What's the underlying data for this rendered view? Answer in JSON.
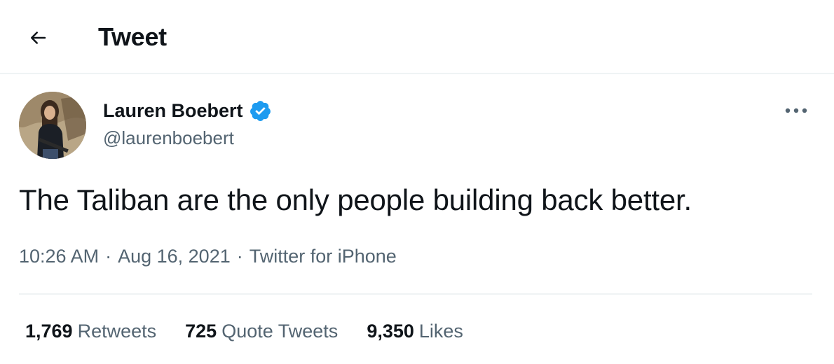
{
  "header": {
    "title": "Tweet",
    "back_icon": "arrow-left-icon"
  },
  "author": {
    "name": "Lauren Boebert",
    "handle": "@laurenboebert",
    "verified": true,
    "verified_color": "#1d9bf0",
    "more_icon": "more-horizontal-icon"
  },
  "tweet": {
    "text": "The Taliban are the only people building back better.",
    "time": "10:26 AM",
    "date": "Aug 16, 2021",
    "source": "Twitter for iPhone",
    "separator": "·"
  },
  "stats": {
    "retweets": {
      "count": "1,769",
      "label": "Retweets"
    },
    "quote_tweets": {
      "count": "725",
      "label": "Quote Tweets"
    },
    "likes": {
      "count": "9,350",
      "label": "Likes"
    }
  },
  "colors": {
    "text_primary": "#0f1419",
    "text_secondary": "#536471",
    "divider": "#eff3f4"
  }
}
